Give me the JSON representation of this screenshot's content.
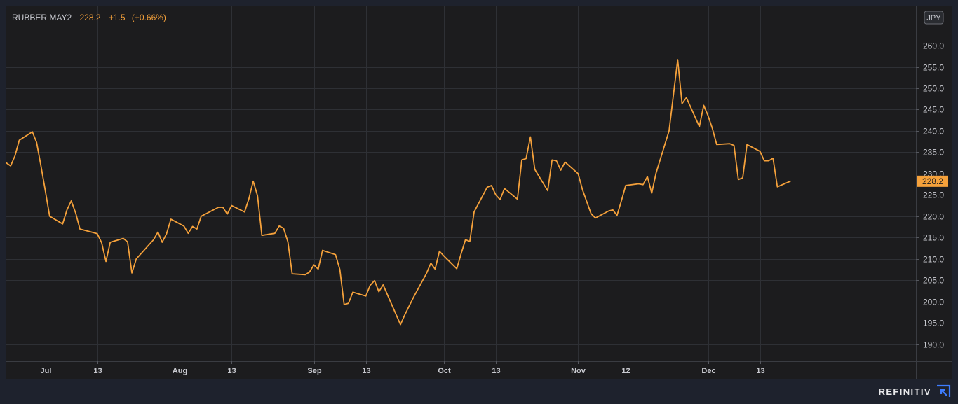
{
  "header": {
    "symbol": "RUBBER MAY2",
    "last": "228.2",
    "change": "+1.5",
    "change_pct": "(+0.66%)"
  },
  "currency": "JPY",
  "brand": "REFINITIV",
  "colors": {
    "background": "#1e222d",
    "plot_background": "#1c1c1e",
    "line": "#f5a13b",
    "price_tag": "#f5a13b",
    "grid": "#2e3035",
    "axis_text": "#c9cad0"
  },
  "chart_data": {
    "type": "line",
    "title": "",
    "xlabel": "",
    "ylabel": "",
    "ylim": [
      186,
      269.2
    ],
    "y_ticks": [
      190,
      195,
      200,
      205,
      210,
      215,
      220,
      225,
      230,
      235,
      240,
      245,
      250,
      255,
      260
    ],
    "x_range": [
      "2021-06-22",
      "2022-01-18"
    ],
    "x_ticks": [
      {
        "date": "2021-07-01",
        "label": "Jul"
      },
      {
        "date": "2021-07-13",
        "label": "13"
      },
      {
        "date": "2021-08-01",
        "label": "Aug"
      },
      {
        "date": "2021-08-13",
        "label": "13"
      },
      {
        "date": "2021-09-01",
        "label": "Sep"
      },
      {
        "date": "2021-09-13",
        "label": "13"
      },
      {
        "date": "2021-10-01",
        "label": "Oct"
      },
      {
        "date": "2021-10-13",
        "label": "13"
      },
      {
        "date": "2021-11-01",
        "label": "Nov"
      },
      {
        "date": "2021-11-12",
        "label": "12"
      },
      {
        "date": "2021-12-01",
        "label": "Dec"
      },
      {
        "date": "2021-12-13",
        "label": "13"
      }
    ],
    "grid": true,
    "last_value": 228.2,
    "last_label": "228.2",
    "series": [
      {
        "points": [
          [
            "2021-06-22",
            232.5
          ],
          [
            "2021-06-23",
            231.8
          ],
          [
            "2021-06-24",
            234.2
          ],
          [
            "2021-06-25",
            237.8
          ],
          [
            "2021-06-28",
            239.8
          ],
          [
            "2021-06-29",
            237.3
          ],
          [
            "2021-06-30",
            231.8
          ],
          [
            "2021-07-01",
            226.0
          ],
          [
            "2021-07-02",
            220.0
          ],
          [
            "2021-07-05",
            218.2
          ],
          [
            "2021-07-06",
            221.5
          ],
          [
            "2021-07-07",
            223.6
          ],
          [
            "2021-07-08",
            220.8
          ],
          [
            "2021-07-09",
            217.0
          ],
          [
            "2021-07-12",
            216.2
          ],
          [
            "2021-07-13",
            215.9
          ],
          [
            "2021-07-14",
            213.8
          ],
          [
            "2021-07-15",
            209.4
          ],
          [
            "2021-07-16",
            213.9
          ],
          [
            "2021-07-19",
            214.8
          ],
          [
            "2021-07-20",
            214.0
          ],
          [
            "2021-07-21",
            206.7
          ],
          [
            "2021-07-22",
            210.0
          ],
          [
            "2021-07-26",
            214.5
          ],
          [
            "2021-07-27",
            216.3
          ],
          [
            "2021-07-28",
            213.9
          ],
          [
            "2021-07-29",
            215.9
          ],
          [
            "2021-07-30",
            219.3
          ],
          [
            "2021-08-02",
            217.7
          ],
          [
            "2021-08-03",
            216.0
          ],
          [
            "2021-08-04",
            217.6
          ],
          [
            "2021-08-05",
            217.0
          ],
          [
            "2021-08-06",
            220.0
          ],
          [
            "2021-08-10",
            222.1
          ],
          [
            "2021-08-11",
            222.1
          ],
          [
            "2021-08-12",
            220.5
          ],
          [
            "2021-08-13",
            222.5
          ],
          [
            "2021-08-16",
            221.0
          ],
          [
            "2021-08-17",
            224.1
          ],
          [
            "2021-08-18",
            228.2
          ],
          [
            "2021-08-19",
            224.8
          ],
          [
            "2021-08-20",
            215.5
          ],
          [
            "2021-08-23",
            216.0
          ],
          [
            "2021-08-24",
            217.7
          ],
          [
            "2021-08-25",
            217.2
          ],
          [
            "2021-08-26",
            214.0
          ],
          [
            "2021-08-27",
            206.5
          ],
          [
            "2021-08-30",
            206.3
          ],
          [
            "2021-08-31",
            206.9
          ],
          [
            "2021-09-01",
            208.6
          ],
          [
            "2021-09-02",
            207.6
          ],
          [
            "2021-09-03",
            212.0
          ],
          [
            "2021-09-06",
            211.0
          ],
          [
            "2021-09-07",
            207.5
          ],
          [
            "2021-09-08",
            199.3
          ],
          [
            "2021-09-09",
            199.6
          ],
          [
            "2021-09-10",
            202.2
          ],
          [
            "2021-09-13",
            201.3
          ],
          [
            "2021-09-14",
            203.8
          ],
          [
            "2021-09-15",
            204.9
          ],
          [
            "2021-09-16",
            202.3
          ],
          [
            "2021-09-17",
            203.9
          ],
          [
            "2021-09-21",
            194.6
          ],
          [
            "2021-09-22",
            196.9
          ],
          [
            "2021-09-24",
            201.0
          ],
          [
            "2021-09-27",
            206.6
          ],
          [
            "2021-09-28",
            209.0
          ],
          [
            "2021-09-29",
            207.6
          ],
          [
            "2021-09-30",
            211.8
          ],
          [
            "2021-10-01",
            210.7
          ],
          [
            "2021-10-04",
            207.7
          ],
          [
            "2021-10-05",
            211.2
          ],
          [
            "2021-10-06",
            214.5
          ],
          [
            "2021-10-07",
            214.1
          ],
          [
            "2021-10-08",
            221.0
          ],
          [
            "2021-10-11",
            226.8
          ],
          [
            "2021-10-12",
            227.2
          ],
          [
            "2021-10-13",
            225.0
          ],
          [
            "2021-10-14",
            223.9
          ],
          [
            "2021-10-15",
            226.5
          ],
          [
            "2021-10-18",
            224.0
          ],
          [
            "2021-10-19",
            233.2
          ],
          [
            "2021-10-20",
            233.5
          ],
          [
            "2021-10-21",
            238.6
          ],
          [
            "2021-10-22",
            231.0
          ],
          [
            "2021-10-25",
            226.0
          ],
          [
            "2021-10-26",
            233.2
          ],
          [
            "2021-10-27",
            233.0
          ],
          [
            "2021-10-28",
            230.8
          ],
          [
            "2021-10-29",
            232.7
          ],
          [
            "2021-11-01",
            230.0
          ],
          [
            "2021-11-02",
            226.3
          ],
          [
            "2021-11-04",
            220.6
          ],
          [
            "2021-11-05",
            219.6
          ],
          [
            "2021-11-08",
            221.2
          ],
          [
            "2021-11-09",
            221.5
          ],
          [
            "2021-11-10",
            220.2
          ],
          [
            "2021-11-11",
            223.6
          ],
          [
            "2021-11-12",
            227.2
          ],
          [
            "2021-11-15",
            227.6
          ],
          [
            "2021-11-16",
            227.4
          ],
          [
            "2021-11-17",
            229.3
          ],
          [
            "2021-11-18",
            225.4
          ],
          [
            "2021-11-19",
            230.1
          ],
          [
            "2021-11-22",
            240.0
          ],
          [
            "2021-11-24",
            256.7
          ],
          [
            "2021-11-25",
            246.4
          ],
          [
            "2021-11-26",
            247.8
          ],
          [
            "2021-11-29",
            241.0
          ],
          [
            "2021-11-30",
            246.0
          ],
          [
            "2021-12-01",
            243.6
          ],
          [
            "2021-12-02",
            240.6
          ],
          [
            "2021-12-03",
            236.8
          ],
          [
            "2021-12-06",
            237.0
          ],
          [
            "2021-12-07",
            236.6
          ],
          [
            "2021-12-08",
            228.6
          ],
          [
            "2021-12-09",
            229.0
          ],
          [
            "2021-12-10",
            236.8
          ],
          [
            "2021-12-13",
            235.2
          ],
          [
            "2021-12-14",
            233.0
          ],
          [
            "2021-12-15",
            233.0
          ],
          [
            "2021-12-16",
            233.6
          ],
          [
            "2021-12-17",
            226.9
          ],
          [
            "2021-12-20",
            228.2
          ]
        ]
      }
    ]
  }
}
